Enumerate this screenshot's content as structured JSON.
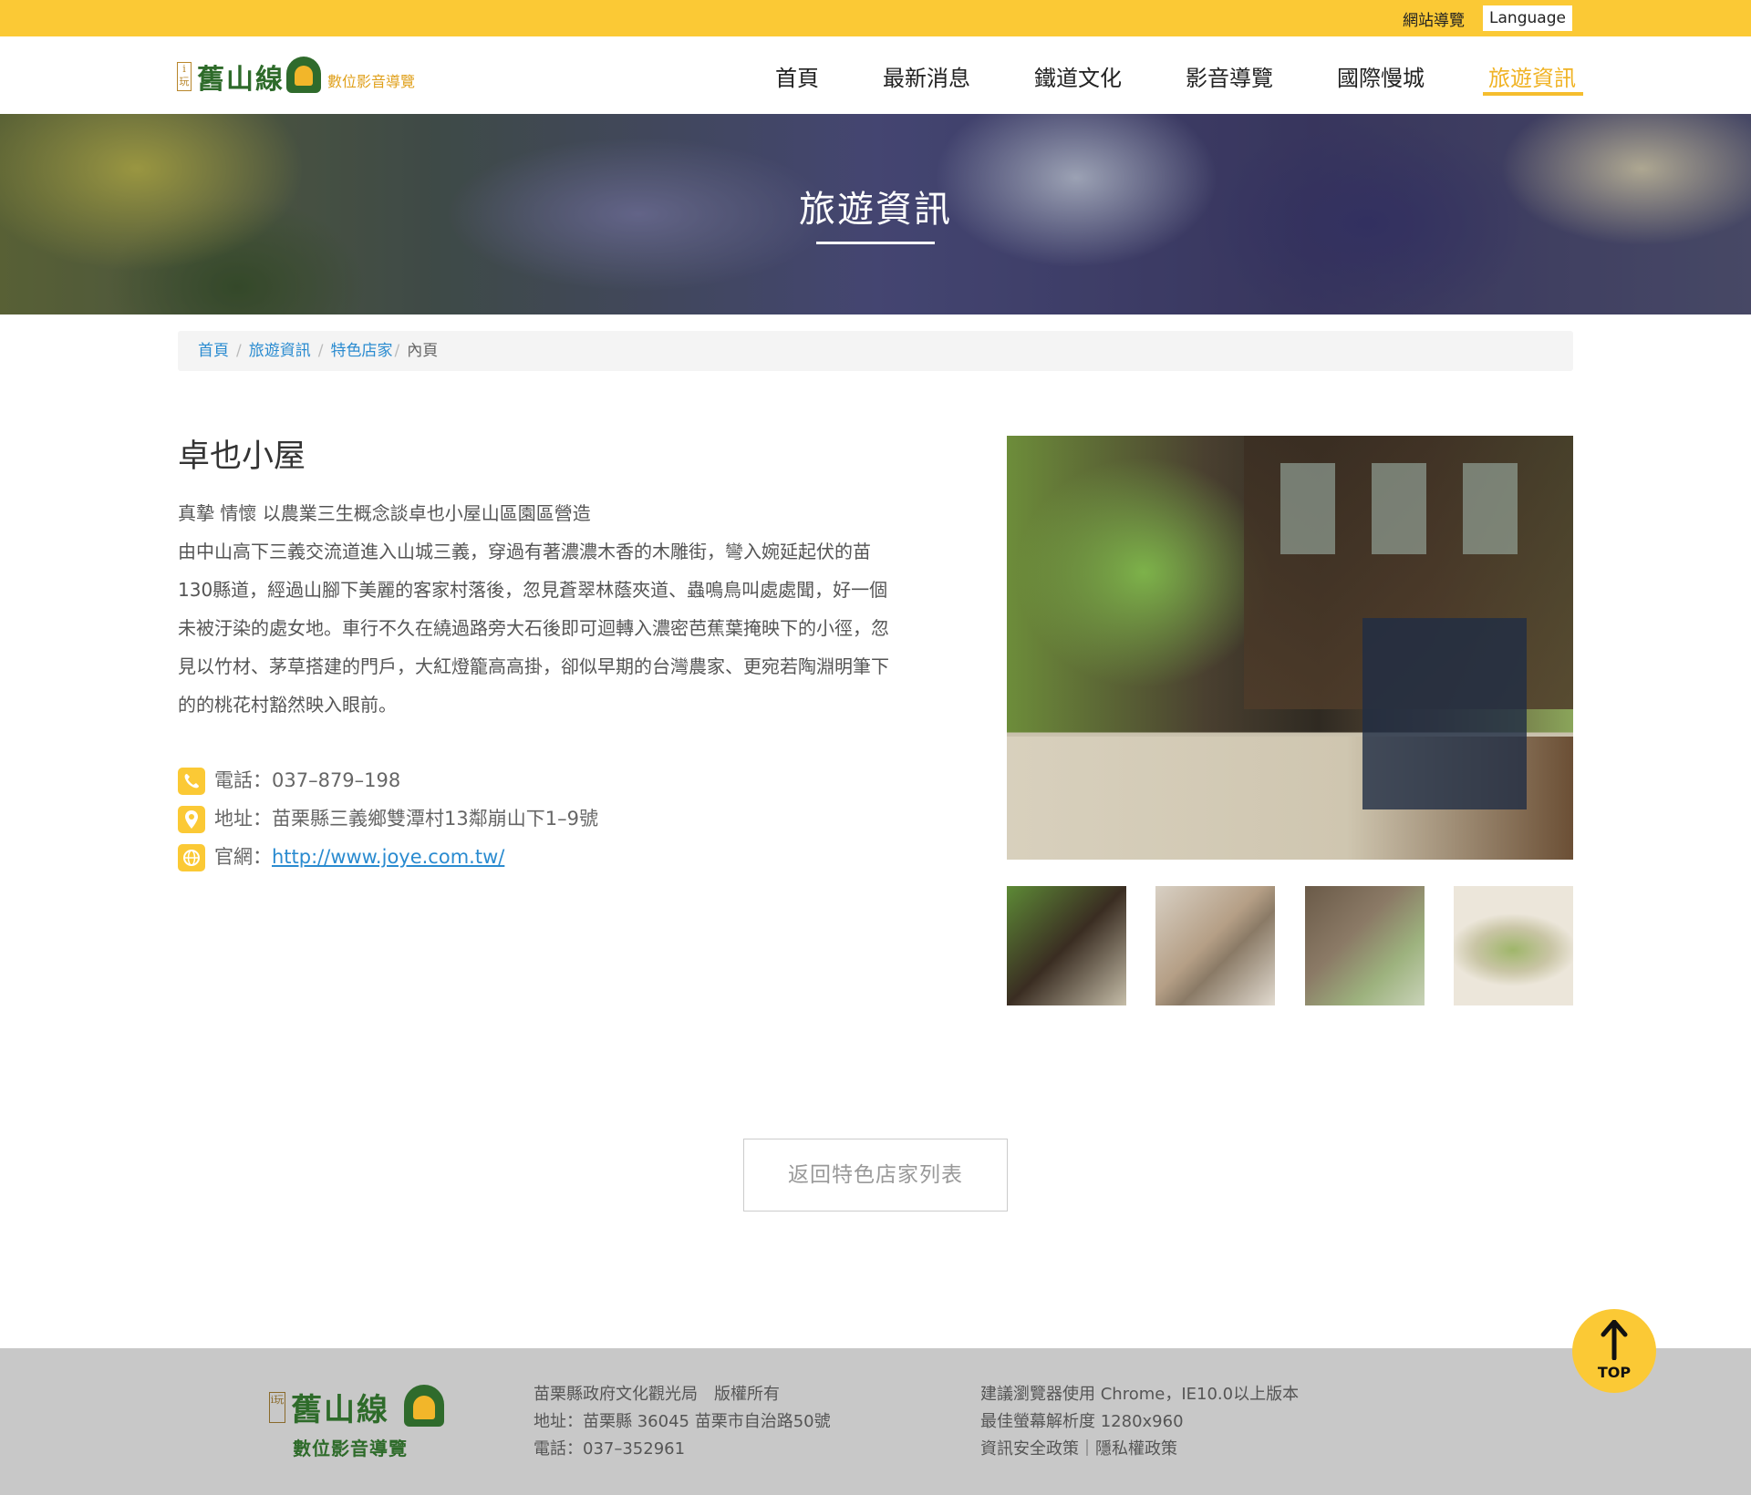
{
  "topbar": {
    "sitemap": "網站導覽",
    "language": "Language"
  },
  "logo": {
    "badge": "i玩",
    "name": "舊山線",
    "subtitle": "數位影音導覽"
  },
  "nav": [
    {
      "label": "首頁"
    },
    {
      "label": "最新消息"
    },
    {
      "label": "鐵道文化"
    },
    {
      "label": "影音導覽"
    },
    {
      "label": "國際慢城"
    },
    {
      "label": "旅遊資訊",
      "active": true
    }
  ],
  "hero": {
    "title": "旅遊資訊"
  },
  "breadcrumb": {
    "items": [
      "首頁",
      "旅遊資訊",
      "特色店家"
    ],
    "current": "內頁",
    "separator": "/"
  },
  "store": {
    "title": "卓也小屋",
    "description": [
      "真摯 情懷 以農業三生概念談卓也小屋山區園區營造",
      "由中山高下三義交流道進入山城三義，穿過有著濃濃木香的木雕街，彎入婉延起伏的苗",
      "130縣道，經過山腳下美麗的客家村落後，忽見蒼翠林蔭夾道、蟲鳴鳥叫處處聞，好一個",
      "未被汙染的處女地。車行不久在繞過路旁大石後即可迴轉入濃密芭蕉葉掩映下的小徑，忽",
      "見以竹材、茅草搭建的門戶，大紅燈籠高高掛，卻似早期的台灣農家、更宛若陶淵明筆下",
      "的的桃花村豁然映入眼前。"
    ],
    "phone_label": "電話：",
    "phone": "037–879–198",
    "address_label": "地址：",
    "address": "苗栗縣三義鄉雙潭村13鄰崩山下1–9號",
    "website_label": "官網：",
    "website": "http://www.joye.com.tw/",
    "icons": {
      "phone": "phone-icon",
      "address": "location-pin-icon",
      "website": "globe-icon"
    }
  },
  "back_button": "返回特色店家列表",
  "footer": {
    "logo_badge": "i玩",
    "logo_name": "舊山線",
    "logo_subtitle": "數位影音導覽",
    "col1": [
      "苗栗縣政府文化觀光局　版權所有",
      "地址：苗栗縣 36045 苗栗市自治路50號",
      "電話：037–352961"
    ],
    "col2": [
      "建議瀏覽器使用 Chrome，IE10.0以上版本",
      "最佳螢幕解析度 1280x960",
      "資訊安全政策｜隱私權政策"
    ]
  },
  "top_button": "TOP",
  "colors": {
    "accent": "#fbc935",
    "link": "#2a8bd0",
    "footer_bg": "#c8c8c8",
    "logo_green": "#2e6b2a"
  }
}
